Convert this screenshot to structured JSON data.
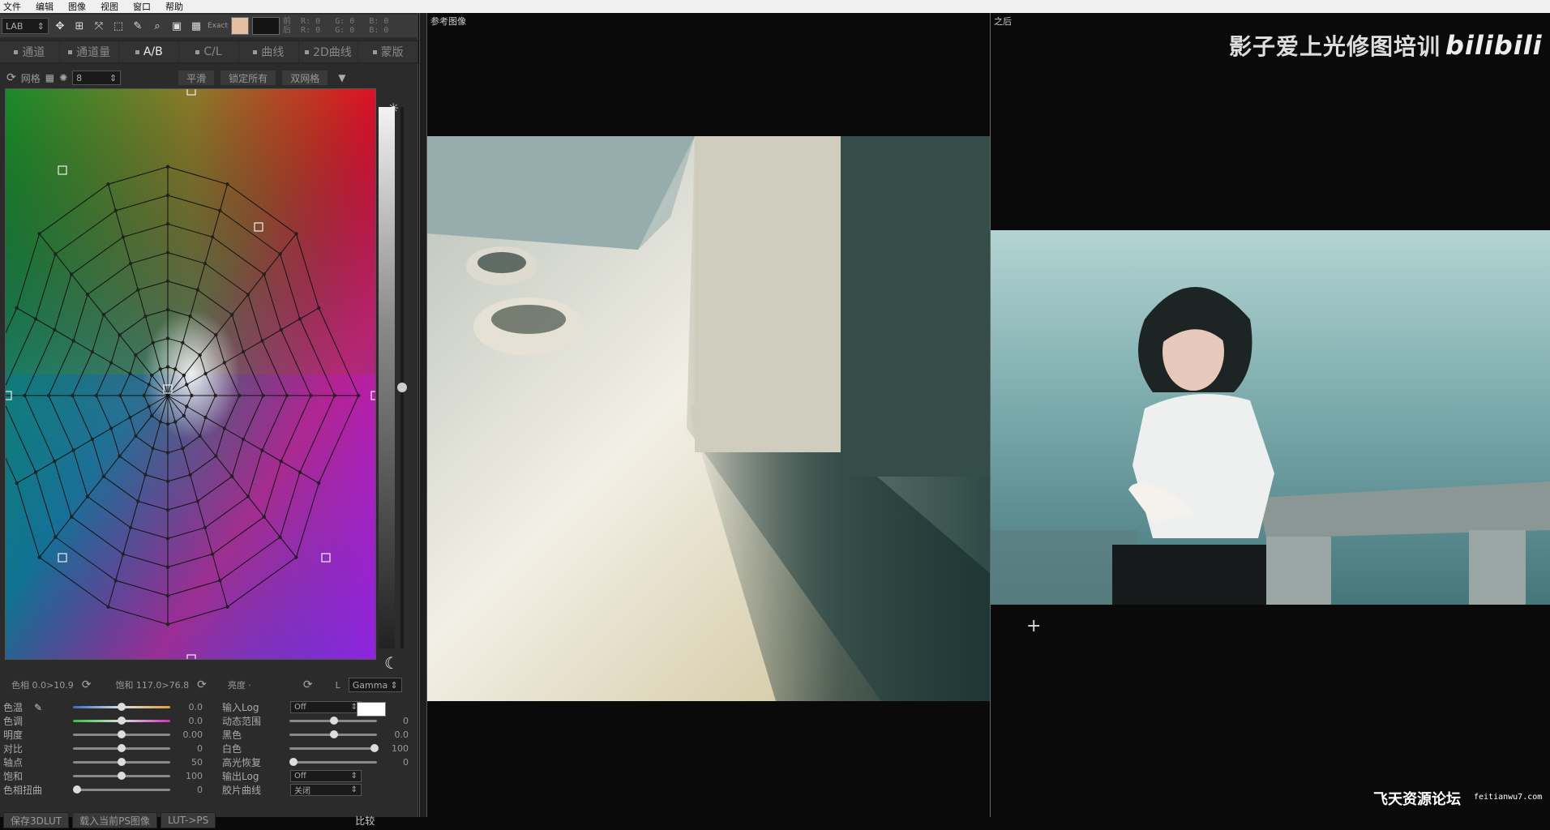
{
  "menu": [
    "文件",
    "编辑",
    "图像",
    "视图",
    "窗口",
    "帮助"
  ],
  "toolbar": {
    "mode_select": "LAB",
    "exact_label": "Exact",
    "fg_color": "#e3c0a4",
    "bg_color": "#141414",
    "readout_front": "前  R: 0   G: 0   B: 0",
    "readout_back": "后  R: 0   G: 0   B: 0"
  },
  "tabs": [
    {
      "label": "通道",
      "active": false
    },
    {
      "label": "通道量",
      "active": false
    },
    {
      "label": "A/B",
      "active": true
    },
    {
      "label": "C/L",
      "active": false
    },
    {
      "label": "曲线",
      "active": false
    },
    {
      "label": "2D曲线",
      "active": false
    },
    {
      "label": "蒙版",
      "active": false
    }
  ],
  "gridbar": {
    "grid_label": "网格",
    "grid_count": "8",
    "smooth_button": "平滑",
    "lock_all_button": "锁定所有",
    "double_grid_button": "双网格"
  },
  "status": {
    "hue": "色相 0.0>10.9",
    "saturation": "饱和 117.0>76.8",
    "brightness": "亮度 ·",
    "l_label": "L",
    "gamma_select": "Gamma"
  },
  "sliders_left": [
    {
      "label": "色温",
      "value": "0.0",
      "pos": 0.5,
      "track": "temp"
    },
    {
      "label": "色调",
      "value": "0.0",
      "pos": 0.5,
      "track": "tint"
    },
    {
      "label": "明度",
      "value": "0.00",
      "pos": 0.5,
      "track": "gray"
    },
    {
      "label": "对比",
      "value": "0",
      "pos": 0.5,
      "track": "gray"
    },
    {
      "label": "轴点",
      "value": "50",
      "pos": 0.5,
      "track": "gray"
    },
    {
      "label": "饱和",
      "value": "100",
      "pos": 0.5,
      "track": "gray"
    },
    {
      "label": "色相扭曲",
      "value": "0",
      "pos": 0.0,
      "track": "gray"
    }
  ],
  "sliders_right": [
    {
      "label": "输入Log",
      "type": "select",
      "value": "Off"
    },
    {
      "label": "动态范围",
      "type": "slider",
      "value": "0",
      "pos": 0.5
    },
    {
      "label": "黑色",
      "type": "slider",
      "value": "0.0",
      "pos": 0.5
    },
    {
      "label": "白色",
      "type": "slider",
      "value": "100",
      "pos": 1.0
    },
    {
      "label": "高光恢复",
      "type": "slider",
      "value": "0",
      "pos": 0.0
    },
    {
      "label": "输出Log",
      "type": "select",
      "value": "Off"
    },
    {
      "label": "胶片曲线",
      "type": "select",
      "value": "关闭"
    }
  ],
  "bottom_buttons": [
    "保存3DLUT",
    "载入当前PS图像",
    "LUT->PS"
  ],
  "compare_button": "比较",
  "panes": {
    "reference_label": "参考图像",
    "after_label": "之后"
  },
  "watermark": {
    "logo_text": "影子爱上光修图培训",
    "bili_text": "bilibili",
    "forum_text": "飞天资源论坛",
    "forum_url": "feitianwu7.com"
  }
}
